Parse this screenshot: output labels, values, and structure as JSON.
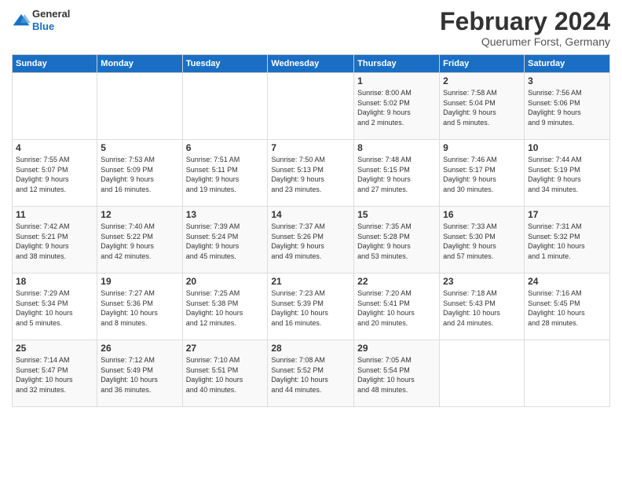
{
  "logo": {
    "text_general": "General",
    "text_blue": "Blue"
  },
  "header": {
    "title": "February 2024",
    "subtitle": "Querumer Forst, Germany"
  },
  "days_of_week": [
    "Sunday",
    "Monday",
    "Tuesday",
    "Wednesday",
    "Thursday",
    "Friday",
    "Saturday"
  ],
  "weeks": [
    [
      {
        "day": "",
        "info": ""
      },
      {
        "day": "",
        "info": ""
      },
      {
        "day": "",
        "info": ""
      },
      {
        "day": "",
        "info": ""
      },
      {
        "day": "1",
        "info": "Sunrise: 8:00 AM\nSunset: 5:02 PM\nDaylight: 9 hours\nand 2 minutes."
      },
      {
        "day": "2",
        "info": "Sunrise: 7:58 AM\nSunset: 5:04 PM\nDaylight: 9 hours\nand 5 minutes."
      },
      {
        "day": "3",
        "info": "Sunrise: 7:56 AM\nSunset: 5:06 PM\nDaylight: 9 hours\nand 9 minutes."
      }
    ],
    [
      {
        "day": "4",
        "info": "Sunrise: 7:55 AM\nSunset: 5:07 PM\nDaylight: 9 hours\nand 12 minutes."
      },
      {
        "day": "5",
        "info": "Sunrise: 7:53 AM\nSunset: 5:09 PM\nDaylight: 9 hours\nand 16 minutes."
      },
      {
        "day": "6",
        "info": "Sunrise: 7:51 AM\nSunset: 5:11 PM\nDaylight: 9 hours\nand 19 minutes."
      },
      {
        "day": "7",
        "info": "Sunrise: 7:50 AM\nSunset: 5:13 PM\nDaylight: 9 hours\nand 23 minutes."
      },
      {
        "day": "8",
        "info": "Sunrise: 7:48 AM\nSunset: 5:15 PM\nDaylight: 9 hours\nand 27 minutes."
      },
      {
        "day": "9",
        "info": "Sunrise: 7:46 AM\nSunset: 5:17 PM\nDaylight: 9 hours\nand 30 minutes."
      },
      {
        "day": "10",
        "info": "Sunrise: 7:44 AM\nSunset: 5:19 PM\nDaylight: 9 hours\nand 34 minutes."
      }
    ],
    [
      {
        "day": "11",
        "info": "Sunrise: 7:42 AM\nSunset: 5:21 PM\nDaylight: 9 hours\nand 38 minutes."
      },
      {
        "day": "12",
        "info": "Sunrise: 7:40 AM\nSunset: 5:22 PM\nDaylight: 9 hours\nand 42 minutes."
      },
      {
        "day": "13",
        "info": "Sunrise: 7:39 AM\nSunset: 5:24 PM\nDaylight: 9 hours\nand 45 minutes."
      },
      {
        "day": "14",
        "info": "Sunrise: 7:37 AM\nSunset: 5:26 PM\nDaylight: 9 hours\nand 49 minutes."
      },
      {
        "day": "15",
        "info": "Sunrise: 7:35 AM\nSunset: 5:28 PM\nDaylight: 9 hours\nand 53 minutes."
      },
      {
        "day": "16",
        "info": "Sunrise: 7:33 AM\nSunset: 5:30 PM\nDaylight: 9 hours\nand 57 minutes."
      },
      {
        "day": "17",
        "info": "Sunrise: 7:31 AM\nSunset: 5:32 PM\nDaylight: 10 hours\nand 1 minute."
      }
    ],
    [
      {
        "day": "18",
        "info": "Sunrise: 7:29 AM\nSunset: 5:34 PM\nDaylight: 10 hours\nand 5 minutes."
      },
      {
        "day": "19",
        "info": "Sunrise: 7:27 AM\nSunset: 5:36 PM\nDaylight: 10 hours\nand 8 minutes."
      },
      {
        "day": "20",
        "info": "Sunrise: 7:25 AM\nSunset: 5:38 PM\nDaylight: 10 hours\nand 12 minutes."
      },
      {
        "day": "21",
        "info": "Sunrise: 7:23 AM\nSunset: 5:39 PM\nDaylight: 10 hours\nand 16 minutes."
      },
      {
        "day": "22",
        "info": "Sunrise: 7:20 AM\nSunset: 5:41 PM\nDaylight: 10 hours\nand 20 minutes."
      },
      {
        "day": "23",
        "info": "Sunrise: 7:18 AM\nSunset: 5:43 PM\nDaylight: 10 hours\nand 24 minutes."
      },
      {
        "day": "24",
        "info": "Sunrise: 7:16 AM\nSunset: 5:45 PM\nDaylight: 10 hours\nand 28 minutes."
      }
    ],
    [
      {
        "day": "25",
        "info": "Sunrise: 7:14 AM\nSunset: 5:47 PM\nDaylight: 10 hours\nand 32 minutes."
      },
      {
        "day": "26",
        "info": "Sunrise: 7:12 AM\nSunset: 5:49 PM\nDaylight: 10 hours\nand 36 minutes."
      },
      {
        "day": "27",
        "info": "Sunrise: 7:10 AM\nSunset: 5:51 PM\nDaylight: 10 hours\nand 40 minutes."
      },
      {
        "day": "28",
        "info": "Sunrise: 7:08 AM\nSunset: 5:52 PM\nDaylight: 10 hours\nand 44 minutes."
      },
      {
        "day": "29",
        "info": "Sunrise: 7:05 AM\nSunset: 5:54 PM\nDaylight: 10 hours\nand 48 minutes."
      },
      {
        "day": "",
        "info": ""
      },
      {
        "day": "",
        "info": ""
      }
    ]
  ]
}
